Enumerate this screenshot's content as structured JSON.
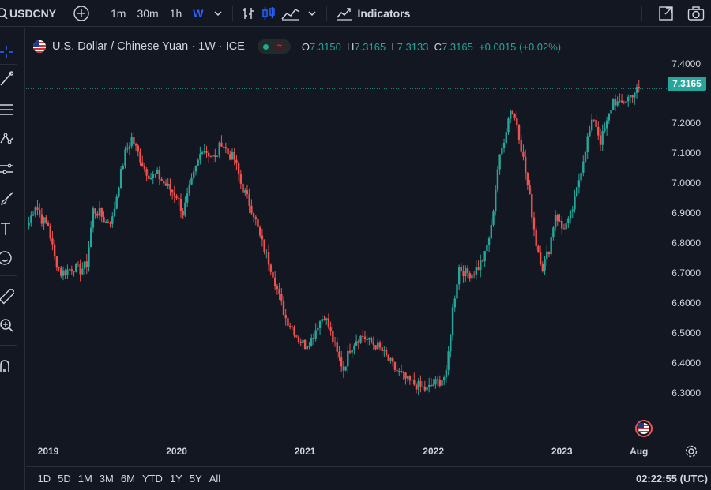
{
  "header": {
    "symbol": "USDCNY",
    "intervals": [
      "1m",
      "30m",
      "1h",
      "W"
    ],
    "active_interval": "W",
    "indicators_label": "Indicators"
  },
  "legend": {
    "title": "U.S. Dollar / Chinese Yuan · 1W · ICE",
    "open_label": "O",
    "open": "7.3150",
    "high_label": "H",
    "high": "7.3165",
    "low_label": "L",
    "low": "7.3133",
    "close_label": "C",
    "close": "7.3165",
    "change": "+0.0015 (+0.02%)"
  },
  "price_axis": {
    "labels": [
      "7.4000",
      "7.2000",
      "7.1000",
      "7.0000",
      "6.9000",
      "6.8000",
      "6.7000",
      "6.6000",
      "6.5000",
      "6.4000",
      "6.3000"
    ],
    "last_price": "7.3165"
  },
  "time_axis": {
    "labels": [
      "2019",
      "2020",
      "2021",
      "2022",
      "2023",
      "Aug"
    ]
  },
  "footer": {
    "ranges": [
      "1D",
      "5D",
      "1M",
      "3M",
      "6M",
      "YTD",
      "1Y",
      "5Y",
      "All"
    ],
    "clock": "02:22:55 (UTC)"
  },
  "colors": {
    "up": "#26a69a",
    "down": "#ef5350",
    "background": "#131722",
    "accent": "#2962ff"
  },
  "chart_data": {
    "type": "candlestick",
    "title": "U.S. Dollar / Chinese Yuan · 1W · ICE",
    "ylim": [
      6.25,
      7.42
    ],
    "xlim": [
      2018.84,
      2023.78
    ],
    "y_ticks": [
      7.4,
      7.2,
      7.1,
      7.0,
      6.9,
      6.8,
      6.7,
      6.6,
      6.5,
      6.4,
      6.3
    ],
    "x_ticks": [
      "2019",
      "2020",
      "2021",
      "2022",
      "2023",
      "Aug"
    ],
    "series": [
      {
        "name": "USDCNY",
        "points": [
          [
            2018.85,
            6.87
          ],
          [
            2018.9,
            6.93
          ],
          [
            2018.95,
            6.88
          ],
          [
            2019.0,
            6.86
          ],
          [
            2019.05,
            6.75
          ],
          [
            2019.1,
            6.7
          ],
          [
            2019.15,
            6.71
          ],
          [
            2019.2,
            6.72
          ],
          [
            2019.25,
            6.71
          ],
          [
            2019.3,
            6.73
          ],
          [
            2019.35,
            6.91
          ],
          [
            2019.4,
            6.9
          ],
          [
            2019.45,
            6.87
          ],
          [
            2019.5,
            6.88
          ],
          [
            2019.55,
            7.0
          ],
          [
            2019.6,
            7.1
          ],
          [
            2019.65,
            7.15
          ],
          [
            2019.7,
            7.1
          ],
          [
            2019.75,
            7.05
          ],
          [
            2019.8,
            7.02
          ],
          [
            2019.85,
            7.03
          ],
          [
            2019.9,
            7.0
          ],
          [
            2019.95,
            6.98
          ],
          [
            2020.0,
            6.96
          ],
          [
            2020.05,
            6.9
          ],
          [
            2020.1,
            6.98
          ],
          [
            2020.15,
            7.05
          ],
          [
            2020.2,
            7.12
          ],
          [
            2020.25,
            7.1
          ],
          [
            2020.3,
            7.08
          ],
          [
            2020.35,
            7.14
          ],
          [
            2020.4,
            7.1
          ],
          [
            2020.45,
            7.08
          ],
          [
            2020.5,
            7.0
          ],
          [
            2020.55,
            6.95
          ],
          [
            2020.6,
            6.9
          ],
          [
            2020.65,
            6.82
          ],
          [
            2020.7,
            6.76
          ],
          [
            2020.75,
            6.7
          ],
          [
            2020.8,
            6.62
          ],
          [
            2020.85,
            6.55
          ],
          [
            2020.9,
            6.52
          ],
          [
            2020.95,
            6.48
          ],
          [
            2021.0,
            6.46
          ],
          [
            2021.05,
            6.48
          ],
          [
            2021.1,
            6.53
          ],
          [
            2021.15,
            6.56
          ],
          [
            2021.2,
            6.5
          ],
          [
            2021.25,
            6.43
          ],
          [
            2021.3,
            6.38
          ],
          [
            2021.35,
            6.45
          ],
          [
            2021.4,
            6.48
          ],
          [
            2021.45,
            6.49
          ],
          [
            2021.5,
            6.47
          ],
          [
            2021.55,
            6.46
          ],
          [
            2021.6,
            6.44
          ],
          [
            2021.65,
            6.41
          ],
          [
            2021.7,
            6.38
          ],
          [
            2021.75,
            6.36
          ],
          [
            2021.8,
            6.34
          ],
          [
            2021.85,
            6.33
          ],
          [
            2021.9,
            6.32
          ],
          [
            2021.95,
            6.31
          ],
          [
            2022.0,
            6.33
          ],
          [
            2022.05,
            6.34
          ],
          [
            2022.1,
            6.36
          ],
          [
            2022.15,
            6.58
          ],
          [
            2022.2,
            6.72
          ],
          [
            2022.25,
            6.7
          ],
          [
            2022.3,
            6.7
          ],
          [
            2022.35,
            6.72
          ],
          [
            2022.4,
            6.76
          ],
          [
            2022.45,
            6.85
          ],
          [
            2022.5,
            7.05
          ],
          [
            2022.55,
            7.15
          ],
          [
            2022.6,
            7.25
          ],
          [
            2022.65,
            7.2
          ],
          [
            2022.7,
            7.08
          ],
          [
            2022.75,
            6.95
          ],
          [
            2022.8,
            6.8
          ],
          [
            2022.85,
            6.72
          ],
          [
            2022.9,
            6.78
          ],
          [
            2022.95,
            6.9
          ],
          [
            2023.0,
            6.85
          ],
          [
            2023.05,
            6.87
          ],
          [
            2023.1,
            6.94
          ],
          [
            2023.15,
            7.05
          ],
          [
            2023.2,
            7.15
          ],
          [
            2023.25,
            7.22
          ],
          [
            2023.3,
            7.14
          ],
          [
            2023.35,
            7.2
          ],
          [
            2023.4,
            7.28
          ],
          [
            2023.45,
            7.26
          ],
          [
            2023.5,
            7.28
          ],
          [
            2023.55,
            7.3
          ],
          [
            2023.6,
            7.3165
          ]
        ]
      }
    ]
  }
}
